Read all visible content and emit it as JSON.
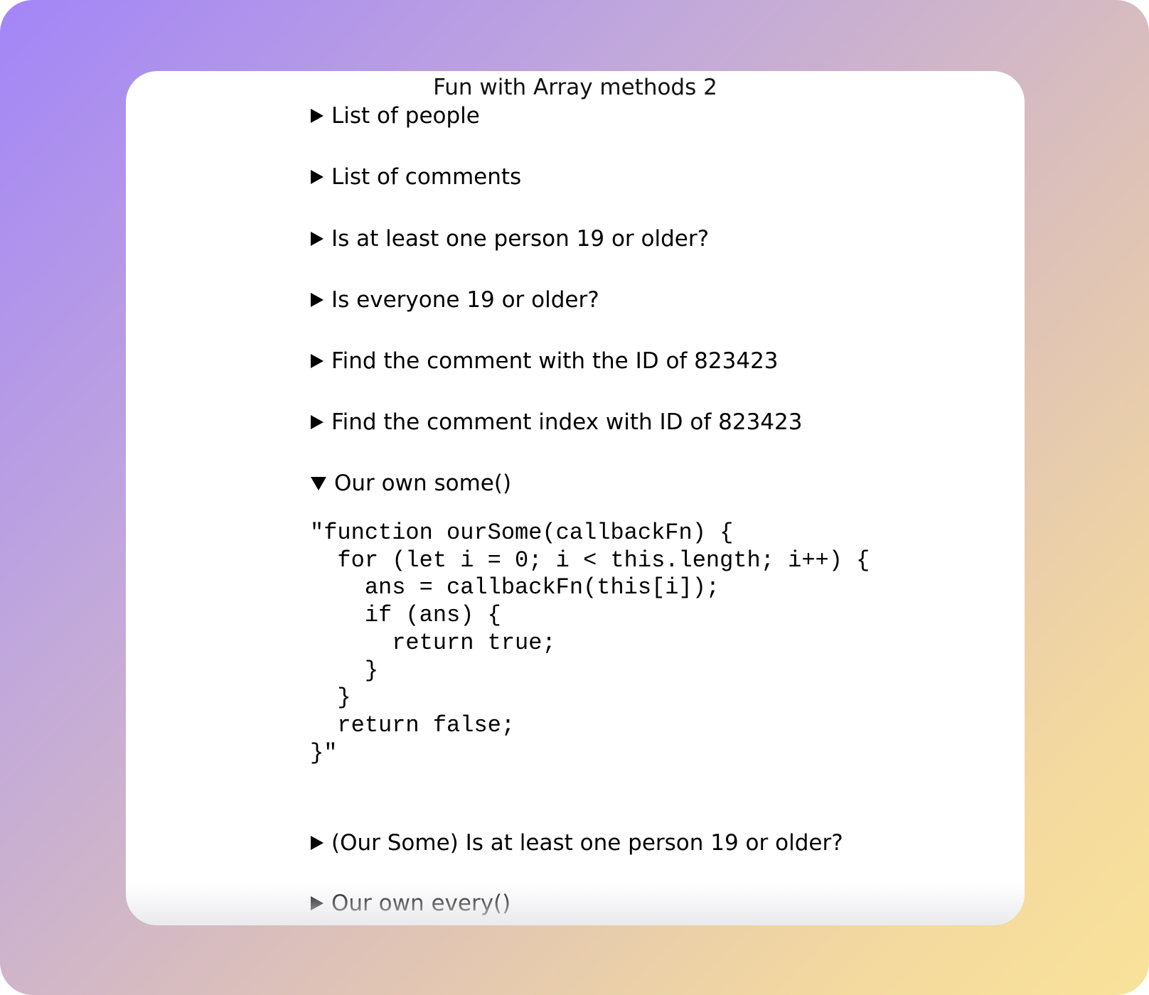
{
  "page": {
    "title": "Fun with Array methods 2"
  },
  "items": [
    {
      "label": "List of people",
      "expanded": false
    },
    {
      "label": "List of comments",
      "expanded": false
    },
    {
      "label": "Is at least one person 19 or older?",
      "expanded": false
    },
    {
      "label": "Is everyone 19 or older?",
      "expanded": false
    },
    {
      "label": "Find the comment with the ID of 823423",
      "expanded": false
    },
    {
      "label": "Find the comment index with ID of 823423",
      "expanded": false
    },
    {
      "label": "Our own some()",
      "expanded": true
    },
    {
      "label": "(Our Some) Is at least one person 19 or older?",
      "expanded": false
    },
    {
      "label": "Our own every()",
      "expanded": false
    }
  ],
  "expanded_content": {
    "code": "\"function ourSome(callbackFn) {\n  for (let i = 0; i < this.length; i++) {\n    ans = callbackFn(this[i]);\n    if (ans) {\n      return true;\n    }\n  }\n  return false;\n}\""
  },
  "icons": {
    "collapsed": "triangle-right-icon",
    "expanded": "triangle-down-icon"
  },
  "colors": {
    "gradient_start": "#a385f7",
    "gradient_end": "#f9e29a",
    "card": "#ffffff",
    "text": "#000000"
  }
}
